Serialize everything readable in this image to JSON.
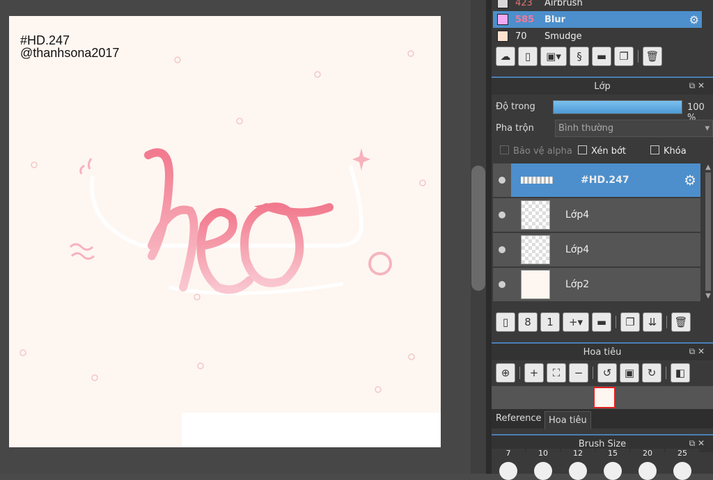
{
  "watermark": {
    "line1": "#HD.247",
    "line2": "@thanhsona2017"
  },
  "artwork": {
    "word": "heo"
  },
  "brush_list": [
    {
      "num": "423",
      "name": "Airbrush",
      "color": "#d8d8d8"
    },
    {
      "num": "585",
      "name": "Blur",
      "color": "#f3a9f3",
      "selected": true
    },
    {
      "num": "70",
      "name": "Smudge",
      "color": "#fde3cf"
    }
  ],
  "layer_panel": {
    "title": "Lớp",
    "opacity_label": "Độ trong",
    "opacity_value": "100 %",
    "opacity_fraction": 1.0,
    "blend_label": "Pha trộn",
    "blend_value": "Bình thường",
    "protect_alpha": "Bảo vệ alpha",
    "clip": "Xén bớt",
    "lock": "Khóa",
    "layers": [
      {
        "name": "#HD.247",
        "selected": true
      },
      {
        "name": "Lớp4"
      },
      {
        "name": "Lớp4"
      },
      {
        "name": "Lớp2"
      }
    ]
  },
  "navigator_panel": {
    "title": "Hoa tiêu",
    "tabs": [
      "Reference",
      "Hoa tiêu"
    ]
  },
  "brush_size_panel": {
    "title": "Brush Size",
    "sizes": [
      "7",
      "10",
      "12",
      "15",
      "20",
      "25"
    ]
  },
  "colors": {
    "accent": "#4d9bd6",
    "selected_row": "#4c8fcc",
    "stroke_pink": "#f2879a"
  }
}
